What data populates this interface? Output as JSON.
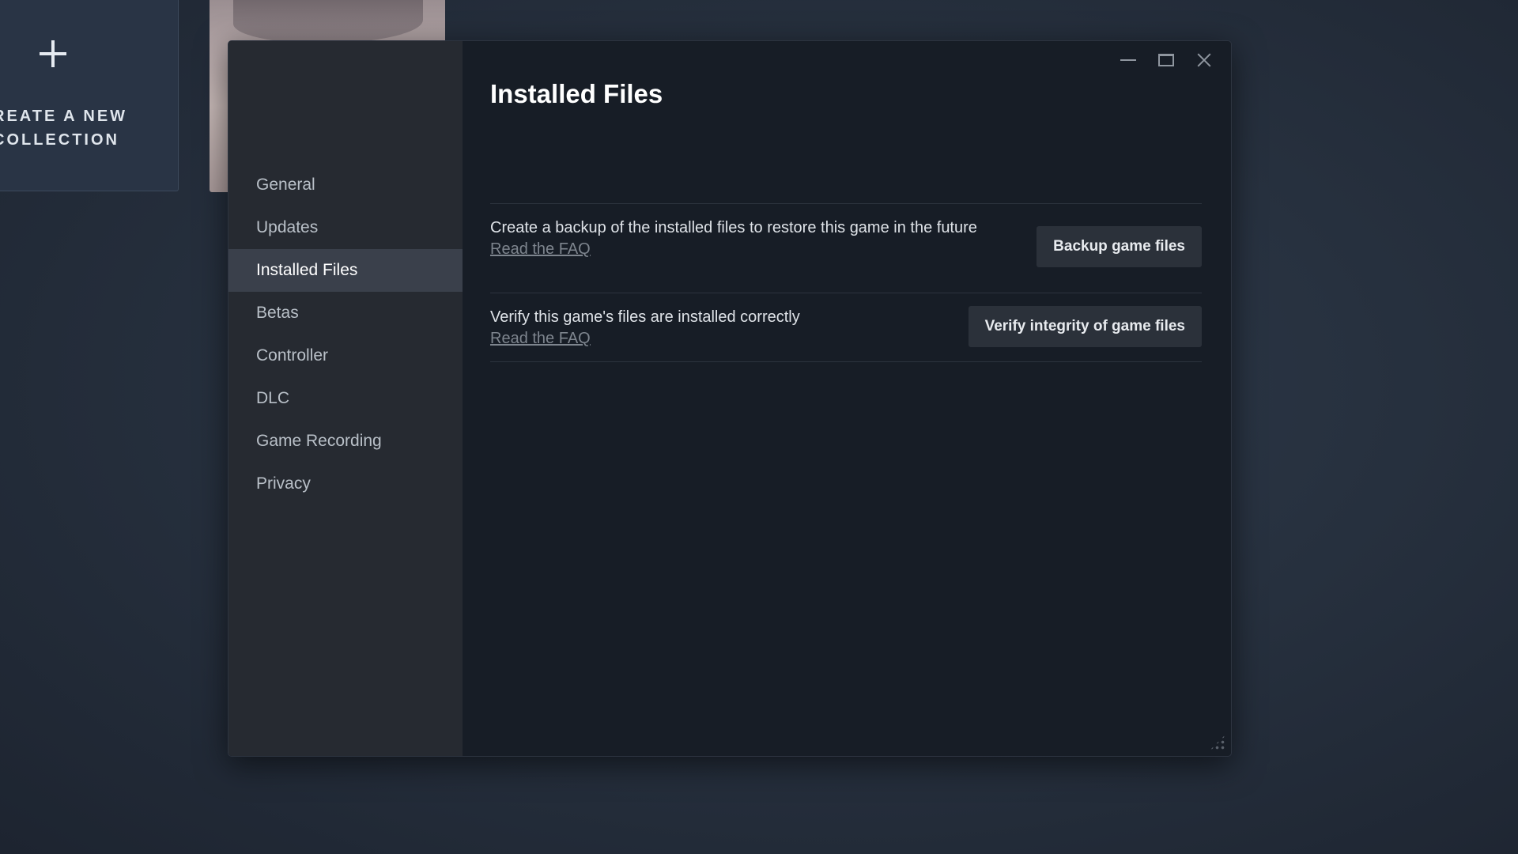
{
  "background": {
    "collection_tile": {
      "line1": "REATE A NEW",
      "line2": "COLLECTION",
      "icon": "plus-icon"
    }
  },
  "window": {
    "controls": [
      "minimize-icon",
      "maximize-icon",
      "close-icon"
    ]
  },
  "sidebar": {
    "items": [
      {
        "label": "General",
        "active": false
      },
      {
        "label": "Updates",
        "active": false
      },
      {
        "label": "Installed Files",
        "active": true
      },
      {
        "label": "Betas",
        "active": false
      },
      {
        "label": "Controller",
        "active": false
      },
      {
        "label": "DLC",
        "active": false
      },
      {
        "label": "Game Recording",
        "active": false
      },
      {
        "label": "Privacy",
        "active": false
      }
    ]
  },
  "main": {
    "title": "Installed Files",
    "rows": [
      {
        "description": "Create a backup of the installed files to restore this game in the future",
        "link": "Read the FAQ",
        "button": "Backup game files"
      },
      {
        "description": "Verify this game's files are installed correctly",
        "link": "Read the FAQ",
        "button": "Verify integrity of game files"
      }
    ]
  },
  "colors": {
    "dialog_bg": "#171d26",
    "sidebar_bg": "#262a31",
    "active_item_bg": "#3a404b",
    "button_bg": "#2b313a"
  }
}
